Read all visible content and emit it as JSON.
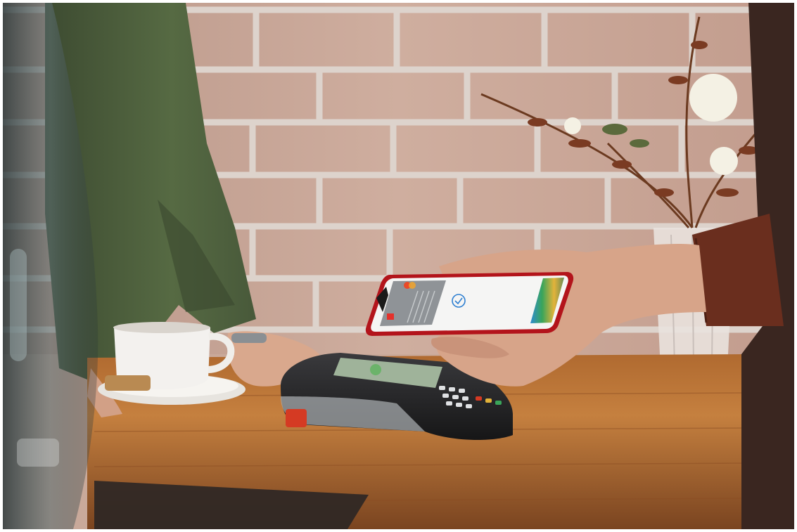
{
  "scene": {
    "colors": {
      "wall": "#c9a79a",
      "mortar": "#ddd3cc",
      "counter": "#9a5a2a",
      "counter_light": "#c5803f",
      "shirt_left": "#4a5a3a",
      "sleeve_right": "#6a2e1e",
      "skin": "#d7a489",
      "phone_frame": "#b3141b",
      "phone_screen": "#f5f5f4",
      "terminal_body": "#2a2a2c",
      "terminal_accent": "#d53a23",
      "terminal_screen": "#9fb39a",
      "cup": "#f3f1ee",
      "cookie": "#b98a52",
      "flowers": "#f4f1e4",
      "stems": "#6b3a20",
      "vase": "#e9e2de"
    },
    "icons": {
      "checkmark": "check-icon",
      "mastercard": "mastercard-icon",
      "bank_logo": "bank-logo-icon"
    }
  }
}
